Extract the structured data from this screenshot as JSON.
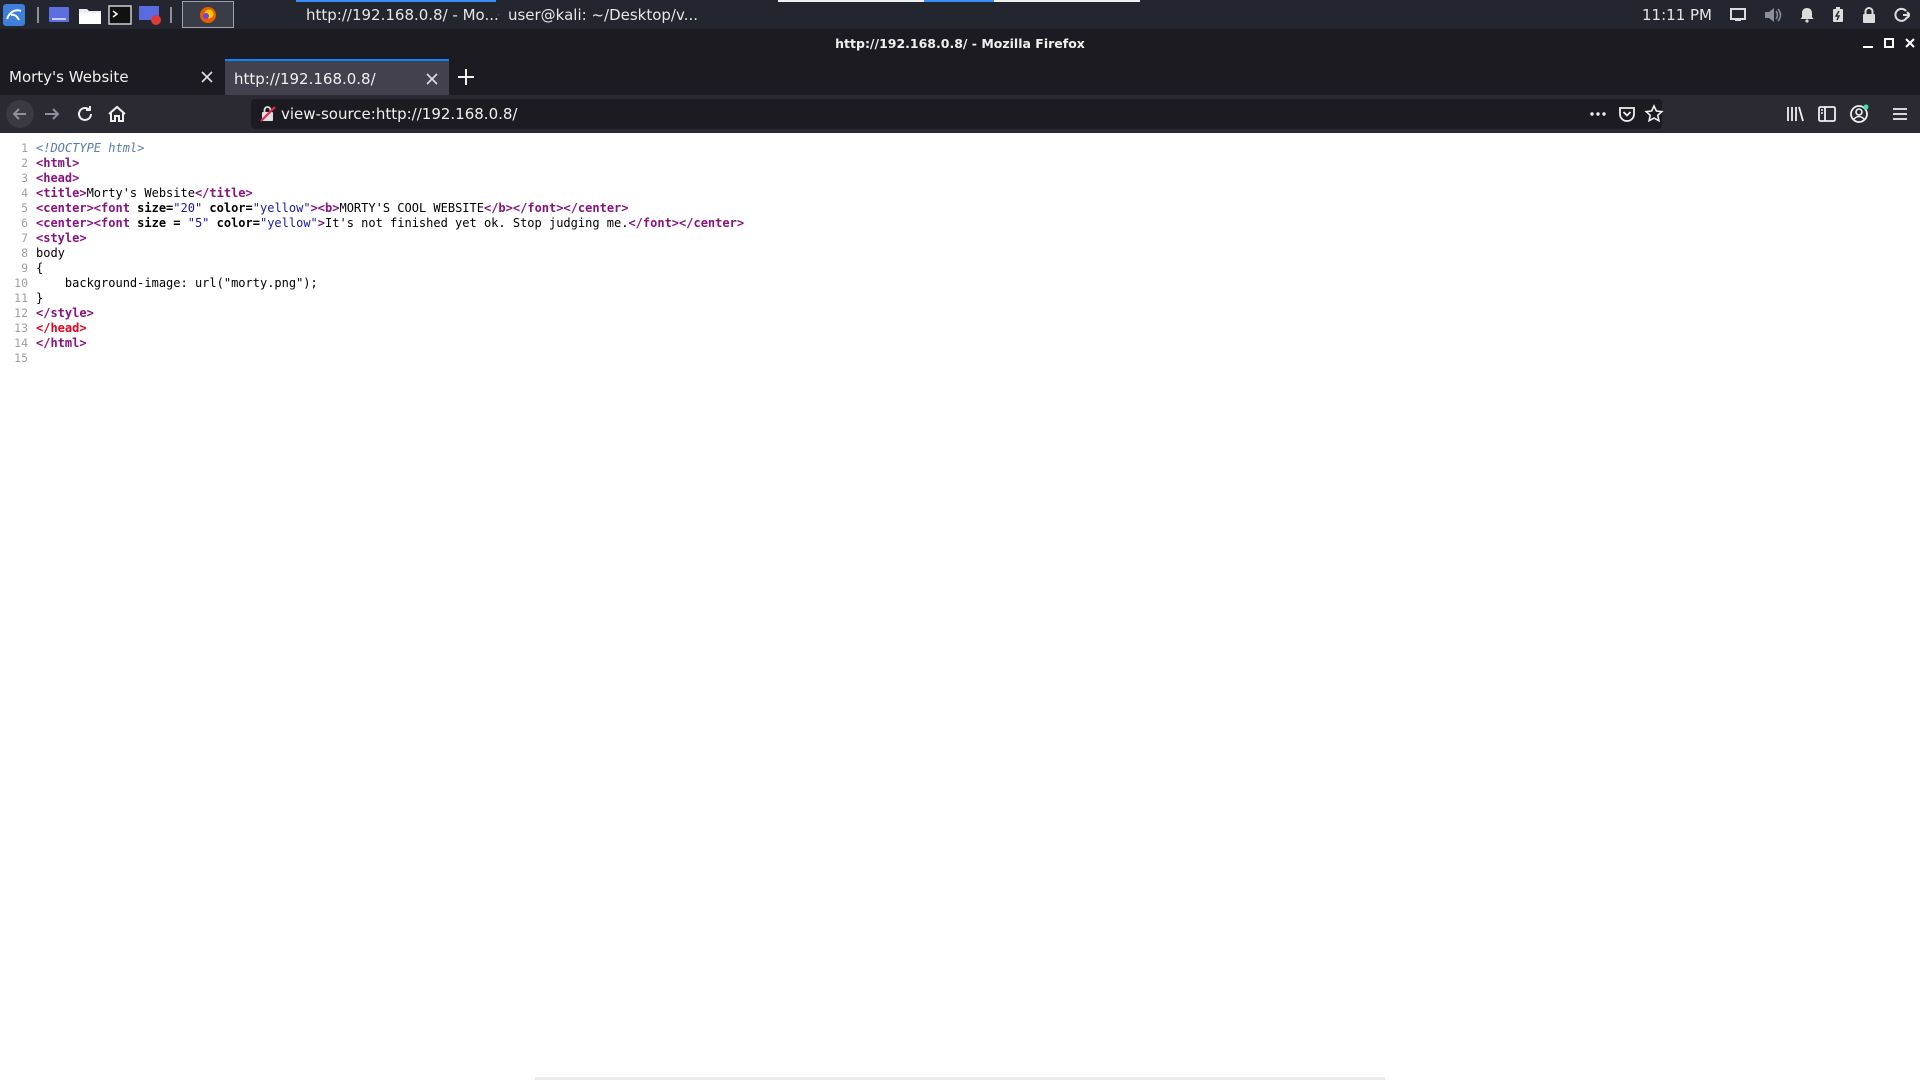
{
  "taskbar": {
    "window_buttons": [
      {
        "label": "http://192.168.0.8/ - Mo..."
      },
      {
        "label": "user@kali: ~/Desktop/v..."
      }
    ],
    "clock": "11:11 PM"
  },
  "browser": {
    "window_title": "http://192.168.0.8/ - Mozilla Firefox",
    "tabs": [
      {
        "label": "Morty's Website"
      },
      {
        "label": "http://192.168.0.8/"
      }
    ],
    "url": "view-source:http://192.168.0.8/"
  },
  "source": {
    "line_numbers": [
      "1",
      "2",
      "3",
      "4",
      "5",
      "6",
      "7",
      "8",
      "9",
      "10",
      "11",
      "12",
      "13",
      "14",
      "15"
    ],
    "l1_doctype": "<!DOCTYPE html>",
    "l2_html_open": "<html>",
    "l3_head_open": "<head>",
    "l4": {
      "tag_open": "<title>",
      "text": "Morty's Website",
      "tag_close": "</title>"
    },
    "l5": {
      "center_open": "<center>",
      "font_open": "<font",
      "attr_size": " size=",
      "val_size": "\"20\"",
      "attr_color": " color=",
      "val_color": "\"yellow\"",
      "gt": ">",
      "b_open": "<b>",
      "text": "MORTY'S COOL WEBSITE",
      "b_close": "</b>",
      "font_close": "</font>",
      "center_close": "</center>"
    },
    "l6": {
      "center_open": "<center>",
      "font_open": "<font",
      "attr_size": " size = ",
      "val_size": "\"5\"",
      "attr_color": " color=",
      "val_color": "\"yellow\"",
      "gt": ">",
      "text": "It's not finished yet ok. Stop judging me.",
      "font_close": "</font>",
      "center_close": "</center>"
    },
    "l7_style_open": "<style>",
    "l8": "body",
    "l9": "{",
    "l10": "    background-image: url(\"morty.png\");",
    "l11": "}",
    "l12_style_close": "</style>",
    "l13_head_close": "</head>",
    "l14_html_close": "</html>",
    "l15": ""
  }
}
